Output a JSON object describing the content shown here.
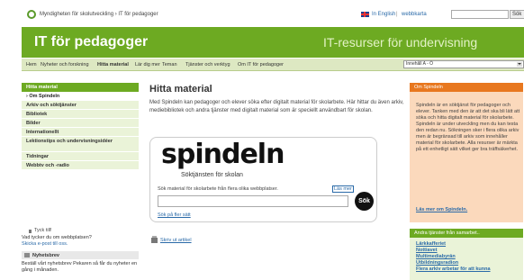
{
  "header": {
    "agency": "Myndigheten för skolutveckling › IT för pedagoger",
    "in_english": "In English",
    "separator": "|",
    "sitemap": "webbkarta",
    "search_button": "Sök"
  },
  "banner": {
    "title": "IT för pedagoger",
    "tagline": "IT-resurser för undervisning"
  },
  "nav": {
    "items": [
      "Hem",
      "Nyheter och forskning",
      "Hitta material",
      "Lär dig mer",
      "Teman",
      "Tjänster och verktyg",
      "Om IT för pedagoger"
    ],
    "select_value": "Innehåll A - Ö"
  },
  "sidebar": {
    "heading": "Hitta material",
    "items": [
      "› Om Spindeln",
      "Arkiv och söktjänster",
      "Bibliotek",
      "Bilder",
      "Internationellt",
      "Lektionstips och undervisningsidéer",
      "Tidningar",
      "Webbtv och -radio"
    ]
  },
  "feedback": {
    "title": "Tyck till!",
    "question": "Vad tycker du om webbplatsen?",
    "link": "Skicka e-post till oss."
  },
  "newsletter": {
    "title": "Nyhetsbrev",
    "text": "Beställ vårt nyhetsbrev Pekaren så får du nyheter en gång i månaden."
  },
  "main": {
    "title": "Hitta material",
    "intro": "Med Spindeln kan pedagoger och elever söka efter digitalt material för skolarbete. Här hittar du även arkiv, mediebibliotek och andra tjänster med digitalt material som är speciellt användbart för skolan.",
    "print_link": "Skriv ut artikel"
  },
  "spindeln": {
    "logo": "spindeln",
    "subtitle": "Söktjänsten för skolan",
    "description": "Sök material för skolarbete från flera olika webbplatser.",
    "read_more": "Läs mer",
    "search_button": "Sök",
    "more_ways": "Sök på fler sätt"
  },
  "about_box": {
    "heading": "Om Spindeln",
    "text": "Spindeln är en söktjänst för pedagoger och elever. Tanken med den är att det ska bli lätt att söka och hitta digitalt material för skolarbete. Spindeln är under utveckling men du kan testa den redan nu. Sökningen sker i flera olika arkiv men är begränsad till arkiv som innehåller material för skolarbete. Alla resurser är märkta på ett enhetligt sätt vilket ger bra träffsäkerhet.",
    "link": "Läs mer om Spindeln."
  },
  "links_box": {
    "heading": "Andra tjänster från samarbet..",
    "items": [
      "Lärkkafferiet",
      "Nottiavet",
      "Multimediabyrån",
      "Utbildningsradion",
      "Flera arkiv arbetar för att kunna"
    ]
  },
  "colors": {
    "brand_green": "#6daa22",
    "accent_orange": "#e8781f"
  }
}
